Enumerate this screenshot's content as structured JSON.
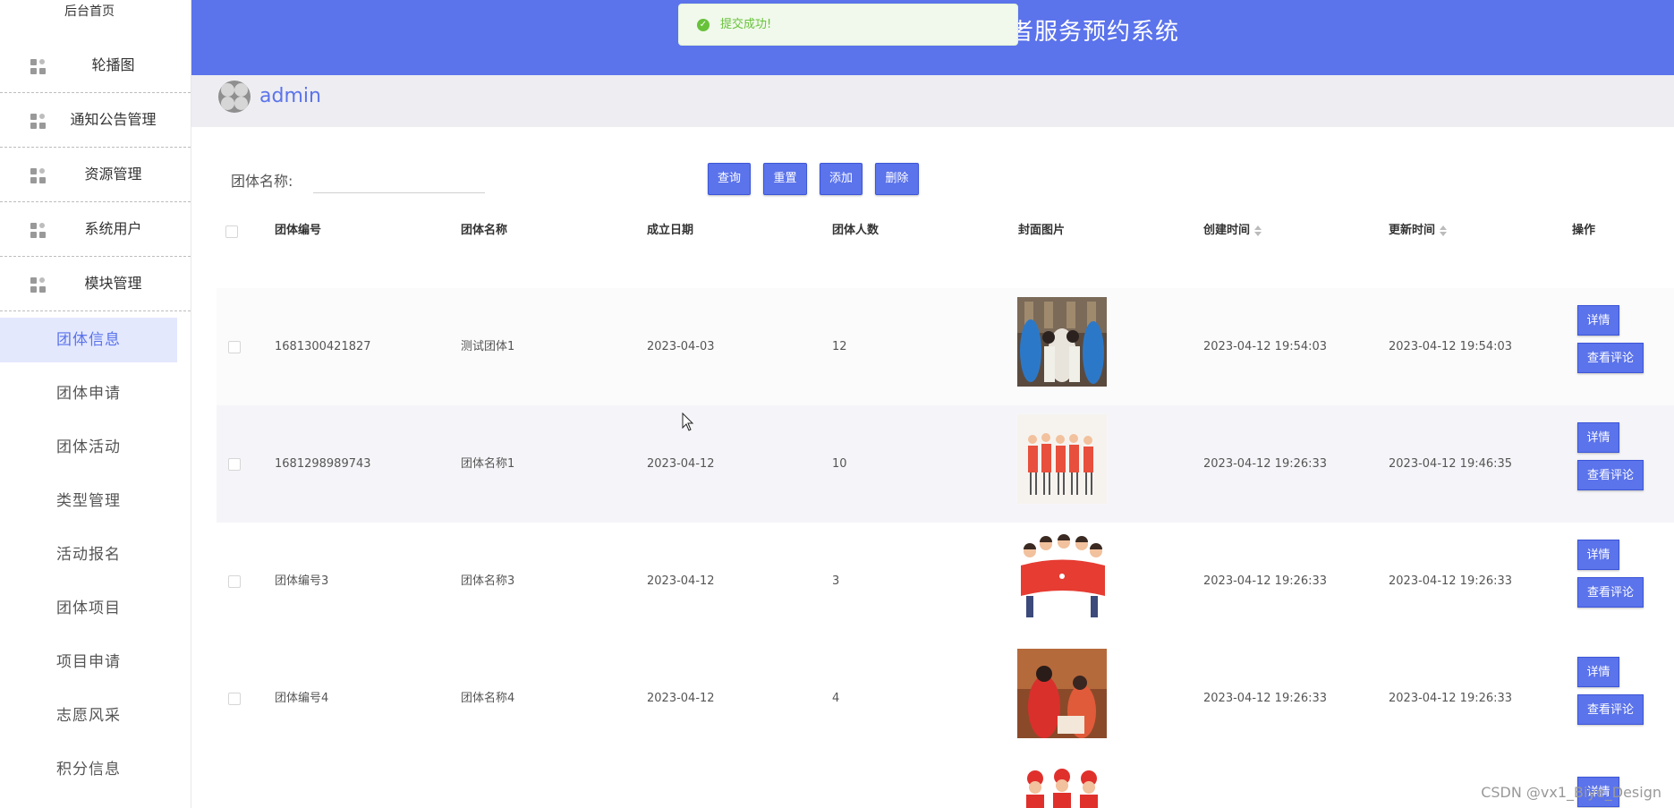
{
  "sidebar": {
    "home": "后台首页",
    "menus": [
      {
        "label": "轮播图",
        "icon": "module-icon"
      },
      {
        "label": "通知公告管理",
        "icon": "module-icon"
      },
      {
        "label": "资源管理",
        "icon": "module-icon"
      },
      {
        "label": "系统用户",
        "icon": "module-icon"
      },
      {
        "label": "模块管理",
        "icon": "module-icon"
      }
    ],
    "submenu": [
      "团体信息",
      "团体申请",
      "团体活动",
      "类型管理",
      "活动报名",
      "团体项目",
      "项目申请",
      "志愿风采",
      "积分信息"
    ],
    "active_submenu": "团体信息"
  },
  "header": {
    "title_visible": "者服务预约系统",
    "bg_color": "#5b73eb"
  },
  "toast": {
    "message": "提交成功!",
    "icon": "check-circle-icon",
    "color": "#67c23a"
  },
  "user": {
    "name": "admin",
    "avatar_icon": "avatar-icon"
  },
  "filter": {
    "label": "团体名称:",
    "value": "",
    "buttons": [
      "查询",
      "重置",
      "添加",
      "删除"
    ]
  },
  "table": {
    "columns": [
      "团体编号",
      "团体名称",
      "成立日期",
      "团体人数",
      "封面图片",
      "创建时间",
      "更新时间",
      "操作"
    ],
    "sortable_columns": [
      "创建时间",
      "更新时间"
    ],
    "rows": [
      {
        "id": "1681300421827",
        "name": "测试团体1",
        "date": "2023-04-03",
        "count": "12",
        "created": "2023-04-12 19:54:03",
        "updated": "2023-04-12 19:54:03"
      },
      {
        "id": "1681298989743",
        "name": "团体名称1",
        "date": "2023-04-12",
        "count": "10",
        "created": "2023-04-12 19:26:33",
        "updated": "2023-04-12 19:46:35"
      },
      {
        "id": "团体编号3",
        "name": "团体名称3",
        "date": "2023-04-12",
        "count": "3",
        "created": "2023-04-12 19:26:33",
        "updated": "2023-04-12 19:26:33"
      },
      {
        "id": "团体编号4",
        "name": "团体名称4",
        "date": "2023-04-12",
        "count": "4",
        "created": "2023-04-12 19:26:33",
        "updated": "2023-04-12 19:26:33"
      }
    ],
    "row_actions": {
      "detail": "详情",
      "comments": "查看评论"
    }
  },
  "watermark": "CSDN @vx1_Biye_Design"
}
